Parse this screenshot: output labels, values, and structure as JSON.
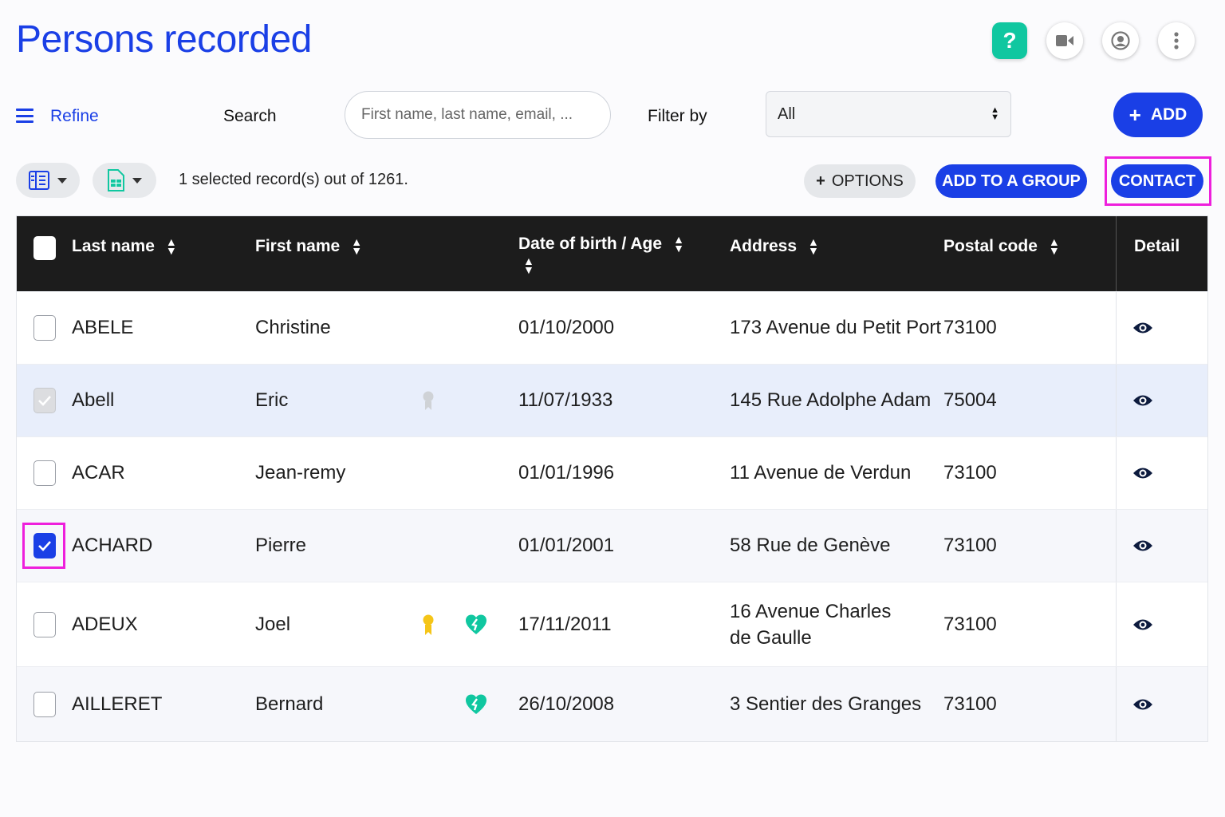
{
  "header": {
    "title": "Persons recorded",
    "help_label": "?"
  },
  "toolbar": {
    "refine_label": "Refine",
    "search_label": "Search",
    "search_placeholder": "First name, last name, email, ...",
    "filter_label": "Filter by",
    "filter_value": "All",
    "add_label": "ADD"
  },
  "actions": {
    "selection_text": "1 selected record(s) out of 1261.",
    "options_label": "OPTIONS",
    "add_group_label": "ADD TO A GROUP",
    "contact_label": "CONTACT"
  },
  "table": {
    "columns": {
      "last_name": "Last name",
      "first_name": "First name",
      "dob": "Date of birth / Age",
      "address": "Address",
      "postal": "Postal code",
      "detail": "Detail"
    },
    "rows": [
      {
        "last": "ABELE",
        "first": "Christine",
        "dob": "01/10/2000",
        "address": "173 Avenue du Petit Port",
        "postal": "73100",
        "checked": false
      },
      {
        "last": "Abell",
        "first": "Eric",
        "dob": "11/07/1933",
        "address": "145 Rue Adolphe Adam",
        "postal": "75004",
        "checked": true,
        "disabled": true,
        "badges": [
          "grey-award-icon"
        ]
      },
      {
        "last": "ACAR",
        "first": "Jean-remy",
        "dob": "01/01/1996",
        "address": "11 Avenue de Verdun",
        "postal": "73100",
        "checked": false
      },
      {
        "last": "ACHARD",
        "first": "Pierre",
        "dob": "01/01/2001",
        "address": "58 Rue de Genève",
        "postal": "73100",
        "checked": true
      },
      {
        "last": "ADEUX",
        "first": "Joel",
        "dob": "17/11/2011",
        "address": "16 Avenue Charles de Gaulle",
        "postal": "73100",
        "checked": false,
        "badges": [
          "yellow-award-icon",
          "teal-heart-icon"
        ]
      },
      {
        "last": "AILLERET",
        "first": "Bernard",
        "dob": "26/10/2008",
        "address": "3 Sentier des Granges",
        "postal": "73100",
        "checked": false,
        "badges": [
          "teal-heart-icon"
        ]
      }
    ]
  },
  "colors": {
    "brand_blue": "#1a3fe6",
    "help_teal": "#10c7a0",
    "highlight_magenta": "#ee1fdc",
    "header_dark": "#1c1c1c",
    "award_yellow": "#f5c518"
  }
}
